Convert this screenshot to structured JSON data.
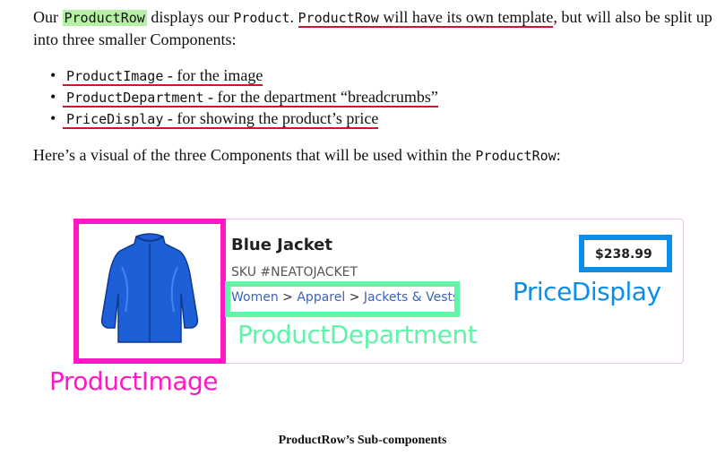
{
  "paragraph1": {
    "t1": "Our ",
    "code1": "ProductRow",
    "t2": " displays our ",
    "code2": "Product",
    "t3": ". ",
    "code3": "ProductRow",
    "t4": " will have its own template",
    "t5": ", but will also be split up into three smaller Components:"
  },
  "list": [
    {
      "code": "ProductImage",
      "text": " - for the image"
    },
    {
      "code": "ProductDepartment",
      "text": " - for the department “breadcrumbs”"
    },
    {
      "code": "PriceDisplay",
      "text": " - for showing the product’s price"
    }
  ],
  "bullet": "•",
  "paragraph2": {
    "t1": "Here’s a visual of the three Components that will be used within the ",
    "code1": "ProductRow",
    "t2": ":"
  },
  "product": {
    "title": "Blue Jacket",
    "sku": "SKU #NEATOJACKET",
    "breadcrumb": [
      "Women",
      "Apparel",
      "Jackets & Vests"
    ],
    "separator": " > ",
    "price": "$238.99"
  },
  "labels": {
    "image": "ProductImage",
    "department": "ProductDepartment",
    "price": "PriceDisplay"
  },
  "caption": "ProductRow’s Sub-components",
  "colors": {
    "image_box": "#ff19c6",
    "department_box": "#5ef5a8",
    "price_box": "#0a8eea",
    "underline": "#d0142c",
    "highlight": "#b6f0a4"
  },
  "icons": {
    "product_image": "blue-jacket-icon"
  }
}
